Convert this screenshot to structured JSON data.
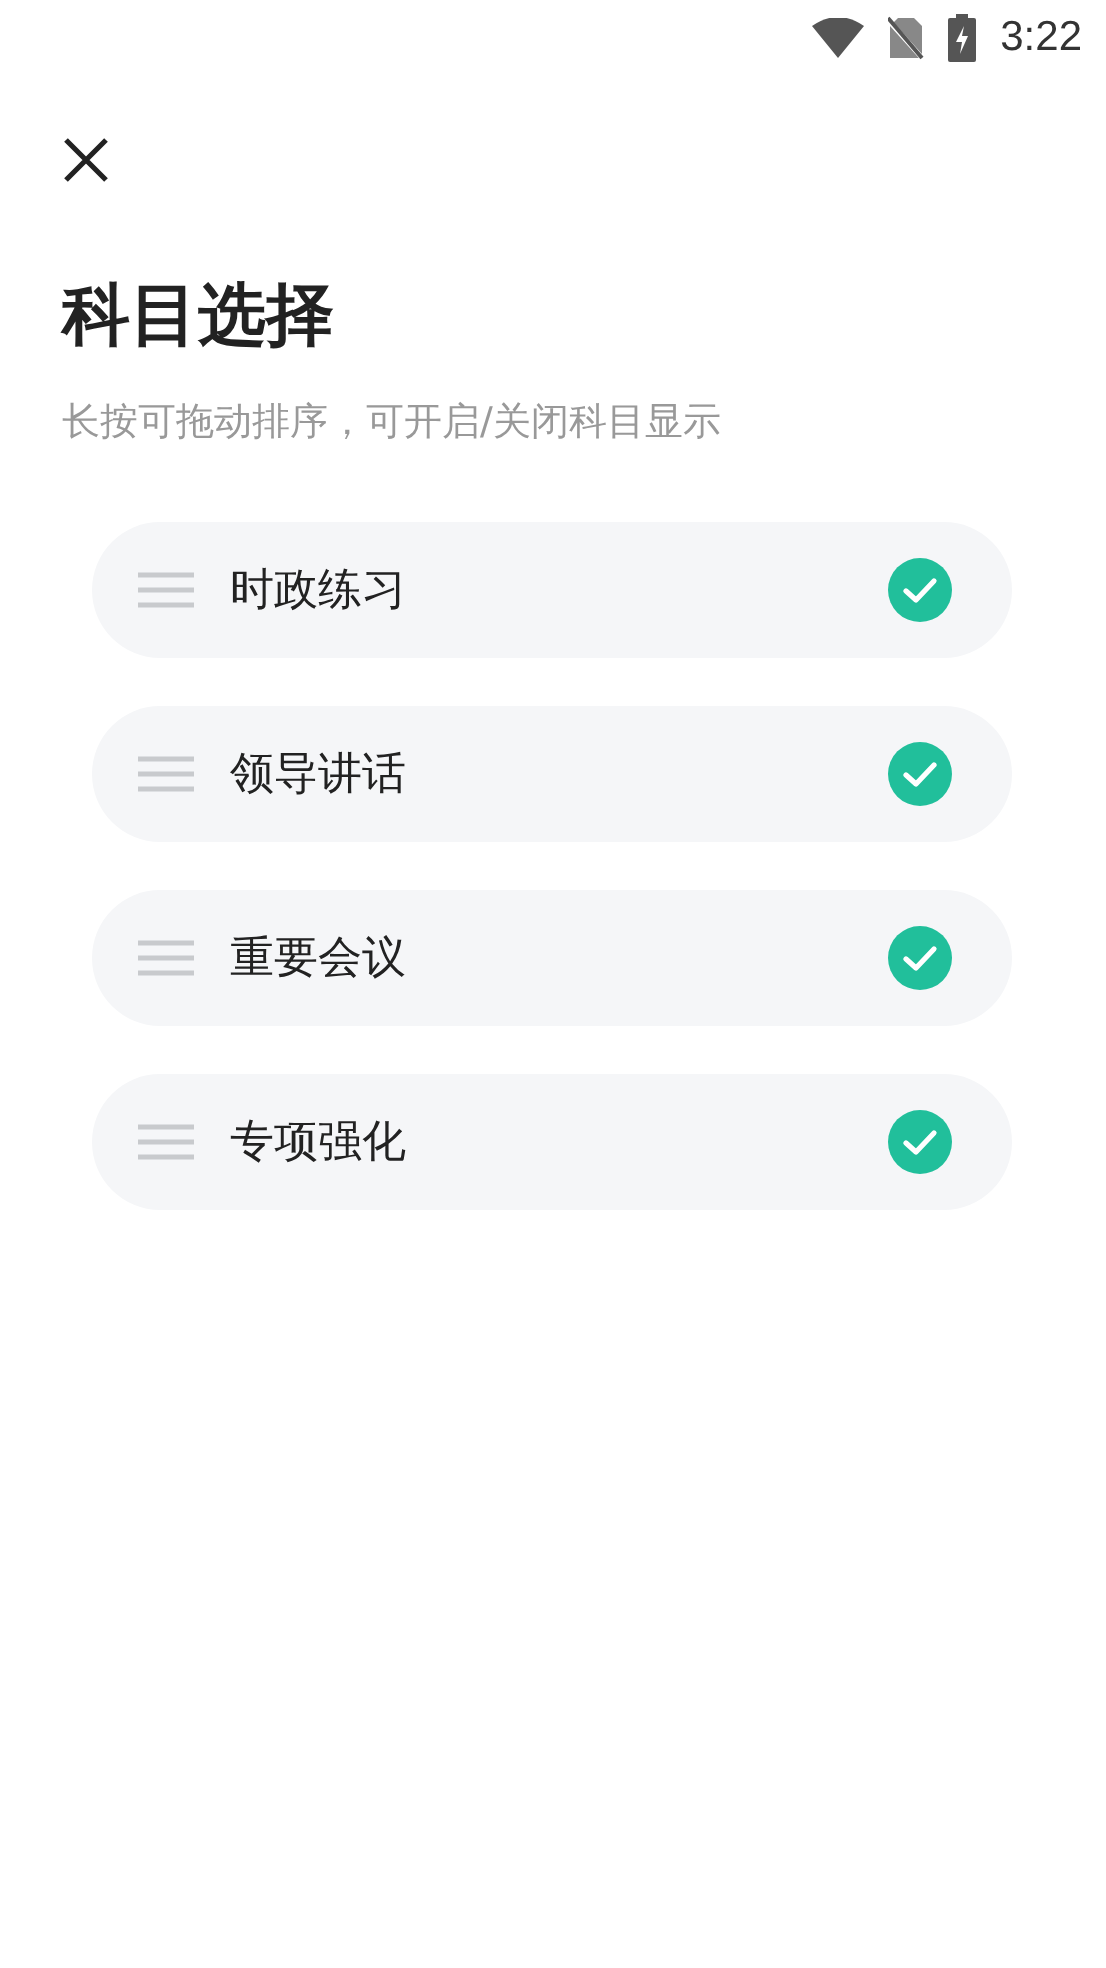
{
  "status_bar": {
    "time": "3:22"
  },
  "title": "科目选择",
  "subtitle": "长按可拖动排序，可开启/关闭科目显示",
  "subjects": [
    {
      "label": "时政练习",
      "checked": true
    },
    {
      "label": "领导讲话",
      "checked": true
    },
    {
      "label": "重要会议",
      "checked": true
    },
    {
      "label": "专项强化",
      "checked": true
    }
  ]
}
